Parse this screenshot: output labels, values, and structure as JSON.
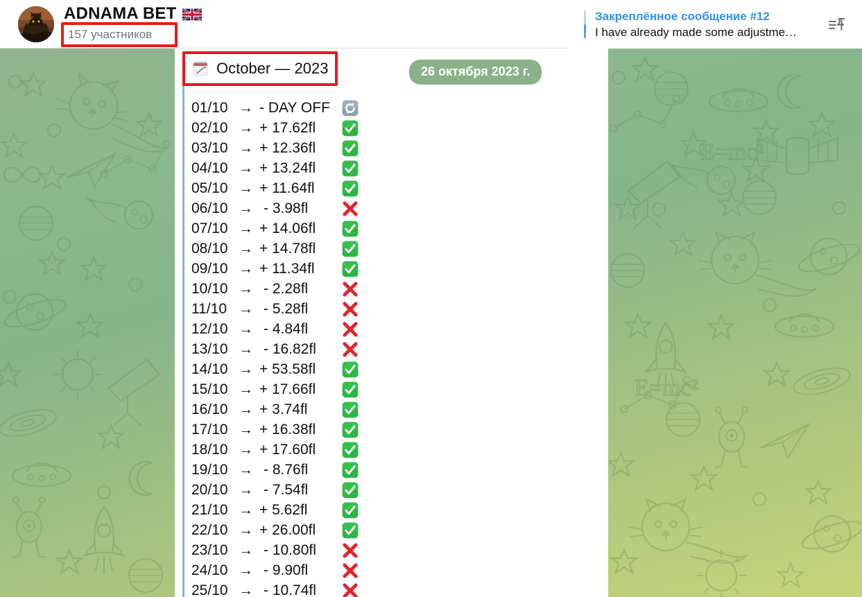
{
  "header": {
    "avatar_name": "channel-avatar",
    "chat_title": "ADNAMA BET",
    "flag_icon": "uk-flag-emoji",
    "members": "157 участников",
    "pinned": {
      "title": "Закреплённое сообщение #12",
      "preview": "I have already made some adjustme…",
      "icon": "pinned-messages-icon"
    }
  },
  "message": {
    "calendar_icon": "spiral-calendar-emoji",
    "heading": "October — 2023",
    "date_badge": "26 октября 2023 г.",
    "rows": [
      {
        "date": "01/10",
        "arrow": "→",
        "amount": "- DAY OFF",
        "sign": "off",
        "status": "recycle-emoji"
      },
      {
        "date": "02/10",
        "arrow": "→",
        "amount": "+ 17.62fl",
        "sign": "pos",
        "status": "check-emoji"
      },
      {
        "date": "03/10",
        "arrow": "→",
        "amount": "+ 12.36fl",
        "sign": "pos",
        "status": "check-emoji"
      },
      {
        "date": "04/10",
        "arrow": "→",
        "amount": "+ 13.24fl",
        "sign": "pos",
        "status": "check-emoji"
      },
      {
        "date": "05/10",
        "arrow": "→",
        "amount": "+ 11.64fl",
        "sign": "pos",
        "status": "check-emoji"
      },
      {
        "date": "06/10",
        "arrow": "→",
        "amount": "- 3.98fl",
        "sign": "neg",
        "status": "cross-emoji"
      },
      {
        "date": "07/10",
        "arrow": "→",
        "amount": "+ 14.06fl",
        "sign": "pos",
        "status": "check-emoji"
      },
      {
        "date": "08/10",
        "arrow": "→",
        "amount": "+ 14.78fl",
        "sign": "pos",
        "status": "check-emoji"
      },
      {
        "date": "09/10",
        "arrow": "→",
        "amount": "+ 11.34fl",
        "sign": "pos",
        "status": "check-emoji"
      },
      {
        "date": "10/10",
        "arrow": "→",
        "amount": "- 2.28fl",
        "sign": "neg",
        "status": "cross-emoji"
      },
      {
        "date": "11/10",
        "arrow": "→",
        "amount": "- 5.28fl",
        "sign": "neg",
        "status": "cross-emoji"
      },
      {
        "date": "12/10",
        "arrow": "→",
        "amount": "- 4.84fl",
        "sign": "neg",
        "status": "cross-emoji"
      },
      {
        "date": "13/10",
        "arrow": "→",
        "amount": "- 16.82fl",
        "sign": "neg",
        "status": "cross-emoji"
      },
      {
        "date": "14/10",
        "arrow": "→",
        "amount": "+ 53.58fl",
        "sign": "pos",
        "status": "check-emoji"
      },
      {
        "date": "15/10",
        "arrow": "→",
        "amount": "+ 17.66fl",
        "sign": "pos",
        "status": "check-emoji"
      },
      {
        "date": "16/10",
        "arrow": "→",
        "amount": "+ 3.74fl",
        "sign": "pos",
        "status": "check-emoji"
      },
      {
        "date": "17/10",
        "arrow": "→",
        "amount": "+ 16.38fl",
        "sign": "pos",
        "status": "check-emoji"
      },
      {
        "date": "18/10",
        "arrow": "→",
        "amount": "+ 17.60fl",
        "sign": "pos",
        "status": "check-emoji"
      },
      {
        "date": "19/10",
        "arrow": "→",
        "amount": "- 8.76fl",
        "sign": "neg",
        "status": "check-emoji"
      },
      {
        "date": "20/10",
        "arrow": "→",
        "amount": "- 7.54fl",
        "sign": "neg",
        "status": "check-emoji"
      },
      {
        "date": "21/10",
        "arrow": "→",
        "amount": "+ 5.62fl",
        "sign": "pos",
        "status": "check-emoji"
      },
      {
        "date": "22/10",
        "arrow": "→",
        "amount": "+ 26.00fl",
        "sign": "pos",
        "status": "check-emoji"
      },
      {
        "date": "23/10",
        "arrow": "→",
        "amount": "- 10.80fl",
        "sign": "neg",
        "status": "cross-emoji"
      },
      {
        "date": "24/10",
        "arrow": "→",
        "amount": "- 9.90fl",
        "sign": "neg",
        "status": "cross-emoji"
      },
      {
        "date": "25/10",
        "arrow": "→",
        "amount": "- 10.74fl",
        "sign": "neg",
        "status": "cross-emoji"
      }
    ]
  },
  "colors": {
    "pinned_title": "#3390ec",
    "highlight_box": "#e8191b",
    "date_badge_bg": "#8ab188",
    "quote_bar": "#8ab4cc",
    "check_green": "#2cb742",
    "cross_red": "#e0262c",
    "wallpaper_top": "#8bb88e",
    "wallpaper_bottom": "#c7d47a"
  }
}
